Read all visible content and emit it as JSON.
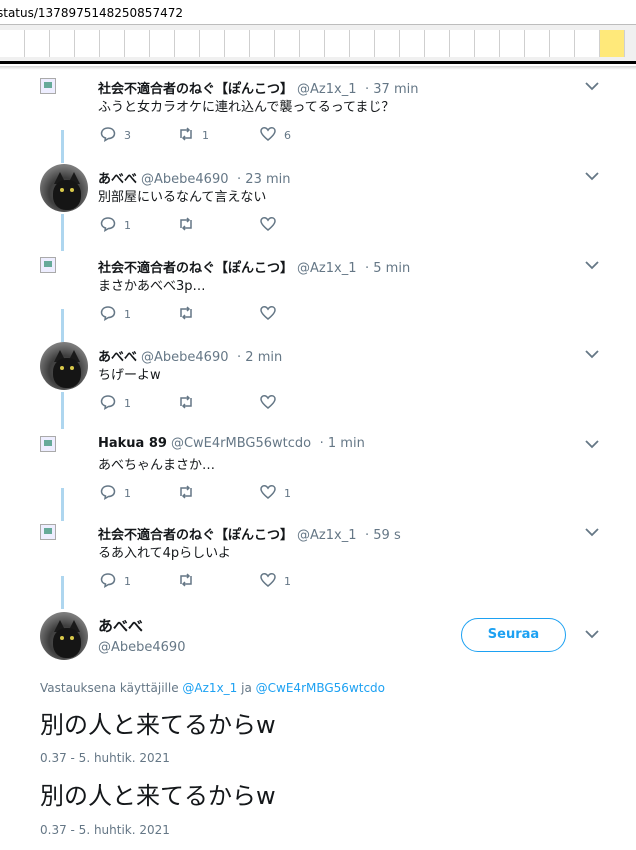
{
  "url": "status/1378975148250857472",
  "tweets": [
    {
      "name": "社会不適合者のねぐ【ぽんこつ】",
      "handle": "@Az1x_1",
      "time": "· 37 min",
      "text": "ふうと女カラオケに連れ込んで襲ってるってまじ？",
      "replies": "3",
      "retweets": "1",
      "likes": "6",
      "avatar": "broken"
    },
    {
      "name": "あべべ",
      "handle": "@Abebe4690",
      "time": "· 23 min",
      "text": "別部屋にいるなんて言えない",
      "replies": "1",
      "retweets": "",
      "likes": "",
      "avatar": "cat"
    },
    {
      "name": "社会不適合者のねぐ【ぽんこつ】",
      "handle": "@Az1x_1",
      "time": "· 5 min",
      "text": "まさかあべべ3p…",
      "replies": "1",
      "retweets": "",
      "likes": "",
      "avatar": "broken"
    },
    {
      "name": "あべべ",
      "handle": "@Abebe4690",
      "time": "· 2 min",
      "text": "ちげーよw",
      "replies": "1",
      "retweets": "",
      "likes": "",
      "avatar": "cat"
    },
    {
      "name": "Hakua 89",
      "handle": "@CwE4rMBG56wtcdo",
      "time": "· 1 min",
      "text": "あべちゃんまさか…",
      "replies": "1",
      "retweets": "",
      "likes": "1",
      "avatar": "broken"
    },
    {
      "name": "社会不適合者のねぐ【ぽんこつ】",
      "handle": "@Az1x_1",
      "time": "· 59 s",
      "text": "るあ入れて4pらしいよ",
      "replies": "1",
      "retweets": "",
      "likes": "1",
      "avatar": "broken"
    }
  ],
  "focus": {
    "name": "あべべ",
    "handle": "@Abebe4690",
    "follow_label": "Seuraa",
    "reply_prefix": "Vastauksena käyttäjille",
    "reply_user1": "@Az1x_1",
    "reply_join": "ja",
    "reply_user2": "@CwE4rMBG56wtcdo",
    "text1": "別の人と来てるからw",
    "time1": "0.37 - 5. huhtik. 2021",
    "text2": "別の人と来てるからw",
    "time2": "0.37 - 5. huhtik. 2021"
  },
  "colors": {
    "accent": "#1da1f2",
    "thread_line": "#aed6ef",
    "muted": "#657786"
  }
}
